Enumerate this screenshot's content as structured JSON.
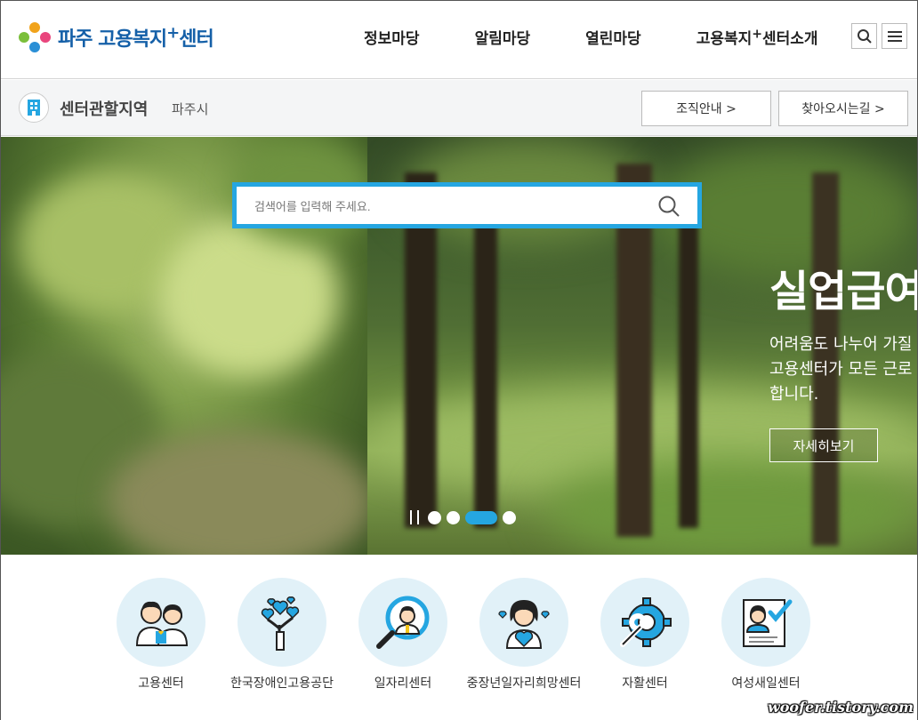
{
  "logo": {
    "text": "파주 고용복지",
    "sup": "+",
    "tail": "센터"
  },
  "nav": {
    "items": [
      {
        "label": "정보마당"
      },
      {
        "label": "알림마당"
      },
      {
        "label": "열린마당"
      },
      {
        "label": "고용복지",
        "sup": "+",
        "tail": "센터소개"
      }
    ]
  },
  "subbar": {
    "title": "센터관할지역",
    "region": "파주시",
    "org_button": "조직안내 >",
    "directions_button": "찾아오시는길 >"
  },
  "search": {
    "placeholder": "검색어를 입력해 주세요."
  },
  "hero": {
    "title": "실업급여",
    "desc_lines": [
      "어려움도 나누어 가질",
      "고용센터가 모든 근로",
      "합니다."
    ],
    "more": "자세히보기",
    "slides_total": 4,
    "slide_active": 3
  },
  "quick": {
    "items": [
      {
        "label": "고용센터",
        "icon": "family-icon"
      },
      {
        "label": "한국장애인고용공단",
        "icon": "heart-tree-icon"
      },
      {
        "label": "일자리센터",
        "icon": "magnifier-person-icon"
      },
      {
        "label": "중장년일자리희망센터",
        "icon": "woman-hearts-icon"
      },
      {
        "label": "자활센터",
        "icon": "gear-wrench-icon"
      },
      {
        "label": "여성새일센터",
        "icon": "certificate-icon"
      }
    ]
  },
  "watermark": "woofer.tistory.com",
  "colors": {
    "accent": "#25a6e1",
    "brand": "#1560a8",
    "circle_bg": "#e1f1f8"
  }
}
